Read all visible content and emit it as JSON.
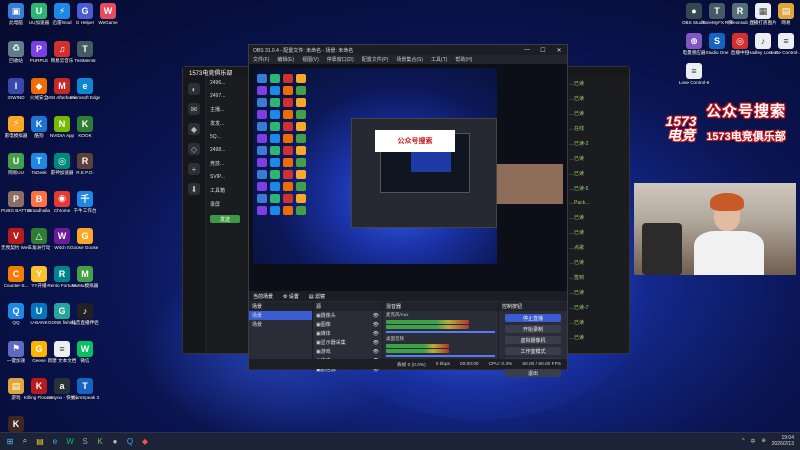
{
  "desktop": {
    "icons": [
      {
        "label": "此电脑",
        "color": "#3a7bd5",
        "glyph": "▣"
      },
      {
        "label": "UU加速器",
        "color": "#2bb673",
        "glyph": "U"
      },
      {
        "label": "迅雷lmod",
        "color": "#1e88e5",
        "glyph": "⚡"
      },
      {
        "label": "G Helper",
        "color": "#4a5bd4",
        "glyph": "G"
      },
      {
        "label": "WeGame",
        "color": "#e84a5f",
        "glyph": "W"
      },
      {
        "label": "回收站",
        "color": "#607d8b",
        "glyph": "♻"
      },
      {
        "label": "PURPLE",
        "color": "#7b3fe4",
        "glyph": "P"
      },
      {
        "label": "网易云音乐",
        "color": "#d32f2f",
        "glyph": "♫"
      },
      {
        "label": "TestMem5",
        "color": "#455a64",
        "glyph": "T"
      },
      {
        "label": "文件",
        "color": "#e0a63b",
        "glyph": "▤"
      },
      {
        "label": "IGWIND",
        "color": "#3949ab",
        "glyph": "I"
      },
      {
        "label": "火绒安全",
        "color": "#ef6c00",
        "glyph": "◆"
      },
      {
        "label": "MSI Afterburner",
        "color": "#c62828",
        "glyph": "M"
      },
      {
        "label": "Microsoft Edge",
        "color": "#0e86d4",
        "glyph": "e"
      },
      {
        "label": "QQ音乐",
        "color": "#20b264",
        "glyph": "♪"
      },
      {
        "label": "雷电模拟器",
        "color": "#f9a825",
        "glyph": "⚡"
      },
      {
        "label": "酷狗",
        "color": "#1976d2",
        "glyph": "K"
      },
      {
        "label": "NVIDIA App",
        "color": "#76b900",
        "glyph": "N"
      },
      {
        "label": "KOOK",
        "color": "#2e7d32",
        "glyph": "K"
      },
      {
        "label": "新建 文本文档",
        "color": "#eceff1",
        "glyph": "≡"
      },
      {
        "label": "网易UU",
        "color": "#43a047",
        "glyph": "U"
      },
      {
        "label": "ToDesk",
        "color": "#1e88e5",
        "glyph": "T"
      },
      {
        "label": "雷神加速器",
        "color": "#00897b",
        "glyph": "◎"
      },
      {
        "label": "R.E.P.O.",
        "color": "#5d4037",
        "glyph": "R"
      },
      {
        "label": "Steam",
        "color": "#1b2838",
        "glyph": "S"
      },
      {
        "label": "PUBG BATTLEG...",
        "color": "#8d6e63",
        "glyph": "P"
      },
      {
        "label": "Broadhalla",
        "color": "#ff7043",
        "glyph": "B"
      },
      {
        "label": "Chrome",
        "color": "#e53935",
        "glyph": "◉"
      },
      {
        "label": "千牛工作台",
        "color": "#1e88e5",
        "glyph": "千"
      },
      {
        "label": "英雄联盟 WeGame版",
        "color": "#c62828",
        "glyph": "L"
      },
      {
        "label": "无畏契约 WeGame版",
        "color": "#b71c1c",
        "glyph": "V"
      },
      {
        "label": "三角洲行动",
        "color": "#2e7d32",
        "glyph": "△"
      },
      {
        "label": "Witch It",
        "color": "#6a1b9a",
        "glyph": "W"
      },
      {
        "label": "Goose Goose Duck",
        "color": "#f9a825",
        "glyph": "G"
      },
      {
        "label": "Golf With Your...",
        "color": "#388e3c",
        "glyph": "G"
      },
      {
        "label": "Counter-S...",
        "color": "#f57c00",
        "glyph": "C"
      },
      {
        "label": "YY开播",
        "color": "#fbc02d",
        "glyph": "Y"
      },
      {
        "label": "Rento Fortune",
        "color": "#00838f",
        "glyph": "R"
      },
      {
        "label": "MuMu模拟器",
        "color": "#43a047",
        "glyph": "M"
      },
      {
        "label": "Funnel Party",
        "color": "#ec407a",
        "glyph": "F"
      },
      {
        "label": "QQ",
        "color": "#1e88e5",
        "glyph": "Q"
      },
      {
        "label": "U-BANK",
        "color": "#0277bd",
        "glyph": "U"
      },
      {
        "label": "GONE fishing",
        "color": "#26a69a",
        "glyph": "G"
      },
      {
        "label": "抖音直播伴侣",
        "color": "#212121",
        "glyph": "♪"
      },
      {
        "label": "WeGame",
        "color": "#e53935",
        "glyph": "W"
      },
      {
        "label": "一键加速",
        "color": "#5c6bc0",
        "glyph": "⚑"
      },
      {
        "label": "Geese",
        "color": "#ffb300",
        "glyph": "G"
      },
      {
        "label": "新建 文本文档",
        "color": "#eceff1",
        "glyph": "≡"
      },
      {
        "label": "微信",
        "color": "#07c160",
        "glyph": "W"
      },
      {
        "label": "猫咪",
        "color": "#ffa726",
        "glyph": "◕"
      },
      {
        "label": "游戏",
        "color": "#e0a63b",
        "glyph": "▤"
      },
      {
        "label": "Killing Floor Beta Card...",
        "color": "#b71c1c",
        "glyph": "K"
      },
      {
        "label": "aunyou - 快捷方式",
        "color": "#263238",
        "glyph": "a"
      },
      {
        "label": "TeamSpeak 3",
        "color": "#1565c0",
        "glyph": "T"
      },
      {
        "label": "新建",
        "color": "#eceff1",
        "glyph": "≡"
      },
      {
        "label": "KILLER INN - BETA",
        "color": "#3e2723",
        "glyph": "K"
      },
      {
        "label": "OBS Studio",
        "color": "#37474f",
        "glyph": "●"
      },
      {
        "label": "ToneMyFX - 快捷方式",
        "color": "#455a64",
        "glyph": "T"
      },
      {
        "label": "Reflexnsub - 快捷方式",
        "color": "#546e7a",
        "glyph": "R"
      },
      {
        "label": "直播打底图片",
        "color": "#eceff1",
        "glyph": "▦"
      },
      {
        "label": "网易",
        "color": "#e0a63b",
        "glyph": "▤"
      },
      {
        "label": "电量感应器",
        "color": "#7e57c2",
        "glyph": "⊕"
      },
      {
        "label": "Studio One",
        "color": "#1565c0",
        "glyph": "S"
      },
      {
        "label": "直播中控",
        "color": "#d32f2f",
        "glyph": "◎"
      },
      {
        "label": "Hadley Lose Control",
        "color": "#eceff1",
        "glyph": "♪"
      },
      {
        "label": "Lose Control-...",
        "color": "#eceff1",
        "glyph": "≡"
      },
      {
        "label": "Lose Control-8...",
        "color": "#eceff1",
        "glyph": "≡"
      }
    ]
  },
  "chat_app": {
    "title": "1573电竞俱乐部",
    "list_items": [
      "2496...",
      "2497...",
      "主播...",
      "发发...",
      "5Q...",
      "2498...",
      "竞技...",
      "SVIP...",
      "工具箱",
      "录屏"
    ],
    "send_label": "发送",
    "right_messages": [
      "…已读",
      "…已读",
      "…已读",
      "…在线",
      "…已读-2",
      "…已读",
      "…已读",
      "…已读-5",
      "…Pack...",
      "…已读",
      "…已读",
      "…点歌",
      "…已读",
      "…签到",
      "…已读",
      "…已读-7",
      "…已读",
      "…已读"
    ]
  },
  "obs": {
    "title": "OBS 31.0.4 - 配置文件: 未命名 - 场景: 未命名",
    "menu": [
      "文件(F)",
      "编辑(E)",
      "视图(V)",
      "停靠窗口(D)",
      "配置文件(P)",
      "场景集合(S)",
      "工具(T)",
      "帮助(H)"
    ],
    "window_controls": [
      "—",
      "☐",
      "✕"
    ],
    "source_bar": [
      "当前场景",
      "⚙ 设置",
      "▤ 滤镜"
    ],
    "docks": {
      "scenes": {
        "title": "场景",
        "items": [
          "场景",
          "场景"
        ]
      },
      "sources": {
        "title": "源",
        "items": [
          "摄像头",
          "图像",
          "媒体",
          "显示器采集",
          "游戏",
          "文本",
          "颜色源"
        ]
      },
      "mixer": {
        "title": "混音器",
        "channels": [
          {
            "name": "麦克风/Aux",
            "level": 0.72
          },
          {
            "name": "桌面音频",
            "level": 0.55
          }
        ]
      },
      "controls": {
        "title": "控制按钮",
        "buttons": [
          "停止直播",
          "开始录制",
          "虚拟摄像机",
          "工作室模式",
          "设置",
          "退出"
        ]
      }
    },
    "status": [
      "丢帧 0 (0.0%)",
      "0 kbps",
      "00:00:00",
      "CPU: 0.3%",
      "60.00 / 60.00 FPS"
    ]
  },
  "overlay": {
    "logo_top": "1573",
    "logo_bottom": "电竞",
    "line1": "公众号搜索",
    "line2": "1573电竞俱乐部",
    "accent": "#c4161c"
  },
  "taskbar": {
    "time": "19:04",
    "date": "2026/2/13",
    "icons": [
      {
        "name": "windows-icon",
        "color": "#4fc3f7",
        "glyph": "⊞"
      },
      {
        "name": "search-icon",
        "color": "#cfd8dc",
        "glyph": "⌕"
      },
      {
        "name": "file-explorer-icon",
        "color": "#ffca28",
        "glyph": "▤"
      },
      {
        "name": "edge-icon",
        "color": "#29b6f6",
        "glyph": "e"
      },
      {
        "name": "wechat-icon",
        "color": "#07c160",
        "glyph": "W"
      },
      {
        "name": "steam-icon",
        "color": "#90a4ae",
        "glyph": "S"
      },
      {
        "name": "kook-icon",
        "color": "#66bb6a",
        "glyph": "K"
      },
      {
        "name": "obs-icon",
        "color": "#b0bec5",
        "glyph": "●"
      },
      {
        "name": "qq-icon",
        "color": "#42a5f5",
        "glyph": "Q"
      },
      {
        "name": "app-icon",
        "color": "#ef5350",
        "glyph": "◆"
      }
    ],
    "tray": [
      "^",
      "中",
      "⊕"
    ]
  }
}
